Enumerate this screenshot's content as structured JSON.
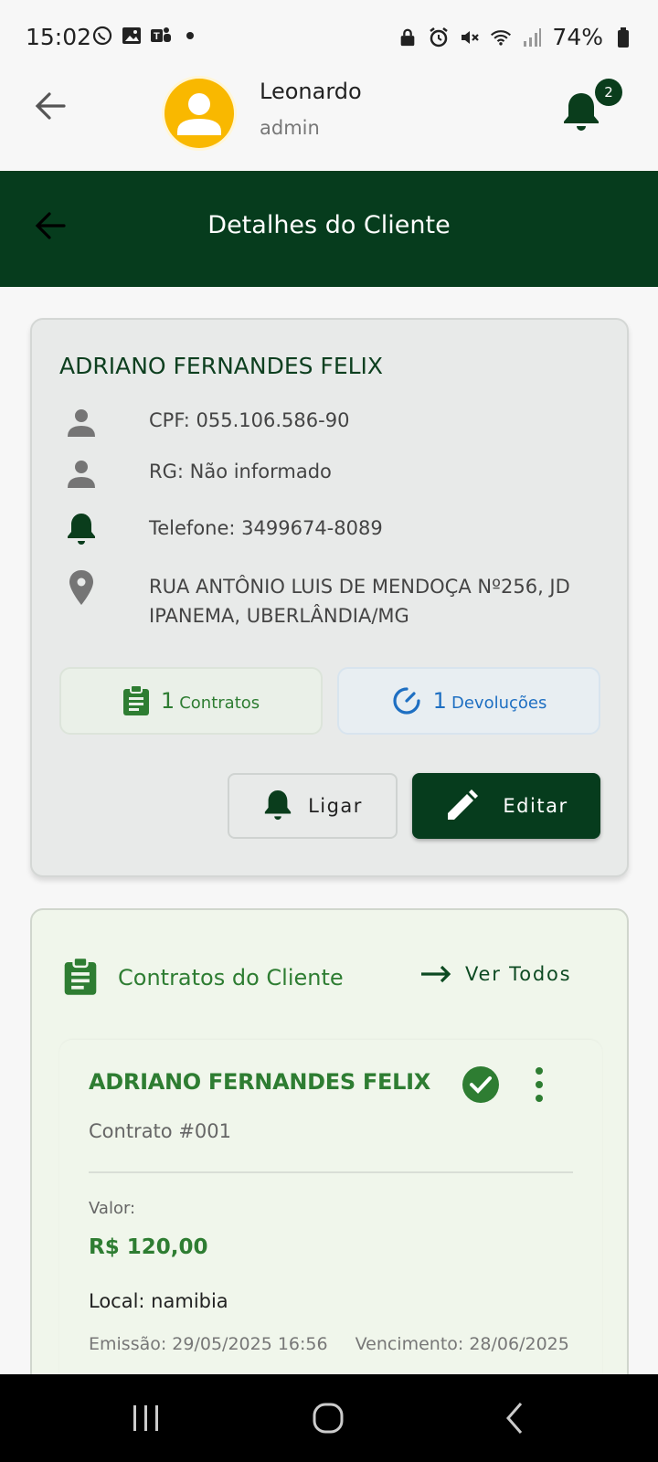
{
  "status_bar": {
    "time": "15:02",
    "battery": "74%",
    "left_icons": [
      "whatsapp-icon",
      "gallery-icon",
      "teams-icon",
      "dot-icon"
    ],
    "right_icons": [
      "lock-icon",
      "alarm-icon",
      "mute-icon",
      "wifi-icon",
      "signal-icon",
      "battery-icon"
    ]
  },
  "header": {
    "user_name": "Leonardo",
    "user_role": "admin",
    "notification_count": "2"
  },
  "title_bar": {
    "title": "Detalhes do Cliente"
  },
  "client": {
    "name": "ADRIANO FERNANDES FELIX",
    "cpf": "CPF: 055.106.586-90",
    "rg": "RG: Não informado",
    "telefone": "Telefone: 3499674-8089",
    "endereco": "RUA ANTÔNIO LUIS DE MENDOÇA Nº256, JD IPANEMA, UBERLÂNDIA/MG",
    "contratos_count": "1",
    "contratos_label": "Contratos",
    "devolucoes_count": "1",
    "devolucoes_label": "Devoluções",
    "ligar_label": "Ligar",
    "editar_label": "Editar"
  },
  "contracts_section": {
    "title": "Contratos do Cliente",
    "ver_todos": "Ver Todos",
    "items": [
      {
        "client_name": "ADRIANO FERNANDES FELIX",
        "number": "Contrato #001",
        "valor_label": "Valor:",
        "valor": "R$ 120,00",
        "local": "Local: namibia",
        "emissao": "Emissão: 29/05/2025 16:56",
        "vencimento": "Vencimento: 28/06/2025"
      }
    ]
  },
  "colors": {
    "primary_dark": "#063c1d",
    "primary_green": "#2e7d32",
    "accent_blue": "#1e6fc2",
    "avatar_yellow": "#f9b800"
  }
}
